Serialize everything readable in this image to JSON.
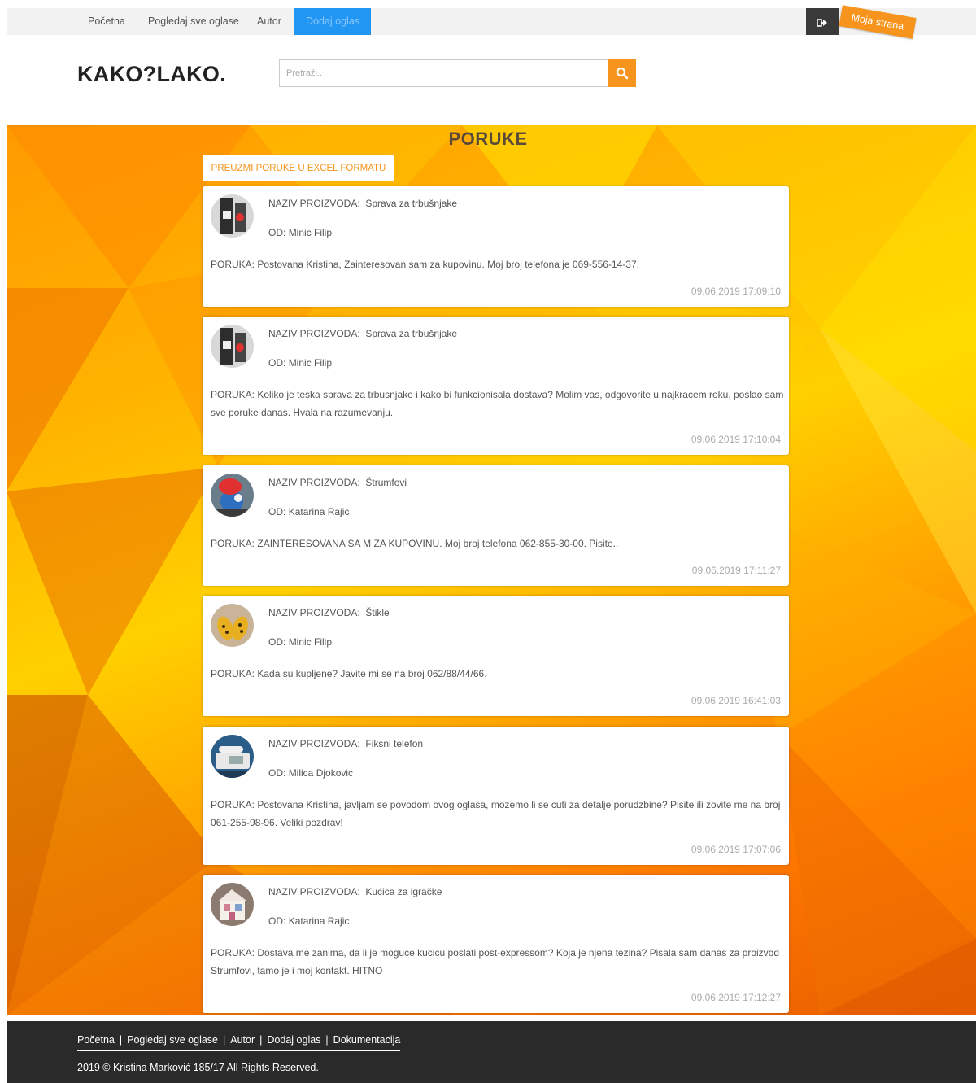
{
  "nav": {
    "items": [
      {
        "label": "Početna"
      },
      {
        "label": "Pogledaj sve oglase"
      },
      {
        "label": "Autor"
      },
      {
        "label": "Dodaj oglas"
      }
    ],
    "moja_strana": "Moja strana"
  },
  "header": {
    "logo": "KAKO?LAKO.",
    "search_placeholder": "Pretraži.."
  },
  "main": {
    "title": "PORUKE",
    "excel_button": "PREUZMI PORUKE U EXCEL FORMATU",
    "product_label": "NAZIV PROIZVODA:",
    "from_label": "OD:",
    "message_label": "PORUKA:",
    "messages": [
      {
        "product": "Sprava za trbušnjake",
        "from": "Minic Filip",
        "text": "Postovana Kristina, Zainteresovan sam za kupovinu. Moj broj telefona je 069-556-14-37.",
        "date": "09.06.2019 17:09:10",
        "avatar": "fitness-device"
      },
      {
        "product": "Sprava za trbušnjake",
        "from": "Minic Filip",
        "text": "Koliko je teska sprava za trbusnjake i kako bi funkcionisala dostava? Molim vas, odgovorite u najkracem roku, poslao sam sve poruke danas. Hvala na razumevanju.",
        "date": "09.06.2019 17:10:04",
        "avatar": "fitness-device"
      },
      {
        "product": "Štrumfovi",
        "from": "Katarina Rajic",
        "text": "ZAINTERESOVANA SA M ZA KUPOVINU. Moj broj telefona 062-855-30-00. Pisite..",
        "date": "09.06.2019 17:11:27",
        "avatar": "smurf-toy"
      },
      {
        "product": "Štikle",
        "from": "Minic Filip",
        "text": "Kada su kupljene? Javite mi se na broj 062/88/44/66.",
        "date": "09.06.2019 16:41:03",
        "avatar": "heels"
      },
      {
        "product": "Fiksni telefon",
        "from": "Milica Djokovic",
        "text": "Postovana Kristina, javljam se povodom ovog oglasa, mozemo li se cuti za detalje porudzbine? Pisite ili zovite me na broj 061-255-98-96. Veliki pozdrav!",
        "date": "09.06.2019 17:07:06",
        "avatar": "landline-phone"
      },
      {
        "product": "Kućica za igračke",
        "from": "Katarina Rajic",
        "text": "Dostava me zanima, da li je moguce kucicu poslati post-expressom? Koja je njena tezina? Pisala sam danas za proizvod Strumfovi, tamo je i moj kontakt. HITNO",
        "date": "09.06.2019 17:12:27",
        "avatar": "toy-house"
      }
    ]
  },
  "footer": {
    "links": [
      {
        "label": "Početna"
      },
      {
        "label": "Pogledaj sve oglase"
      },
      {
        "label": "Autor"
      },
      {
        "label": "Dodaj oglas"
      },
      {
        "label": "Dokumentacija"
      }
    ],
    "separator": "|",
    "copyright": "2019 © Kristina Marković 185/17 All Rights Reserved."
  },
  "colors": {
    "accent": "#f7941d",
    "active_nav": "#2196f3",
    "footer_bg": "#2a2a2a"
  }
}
